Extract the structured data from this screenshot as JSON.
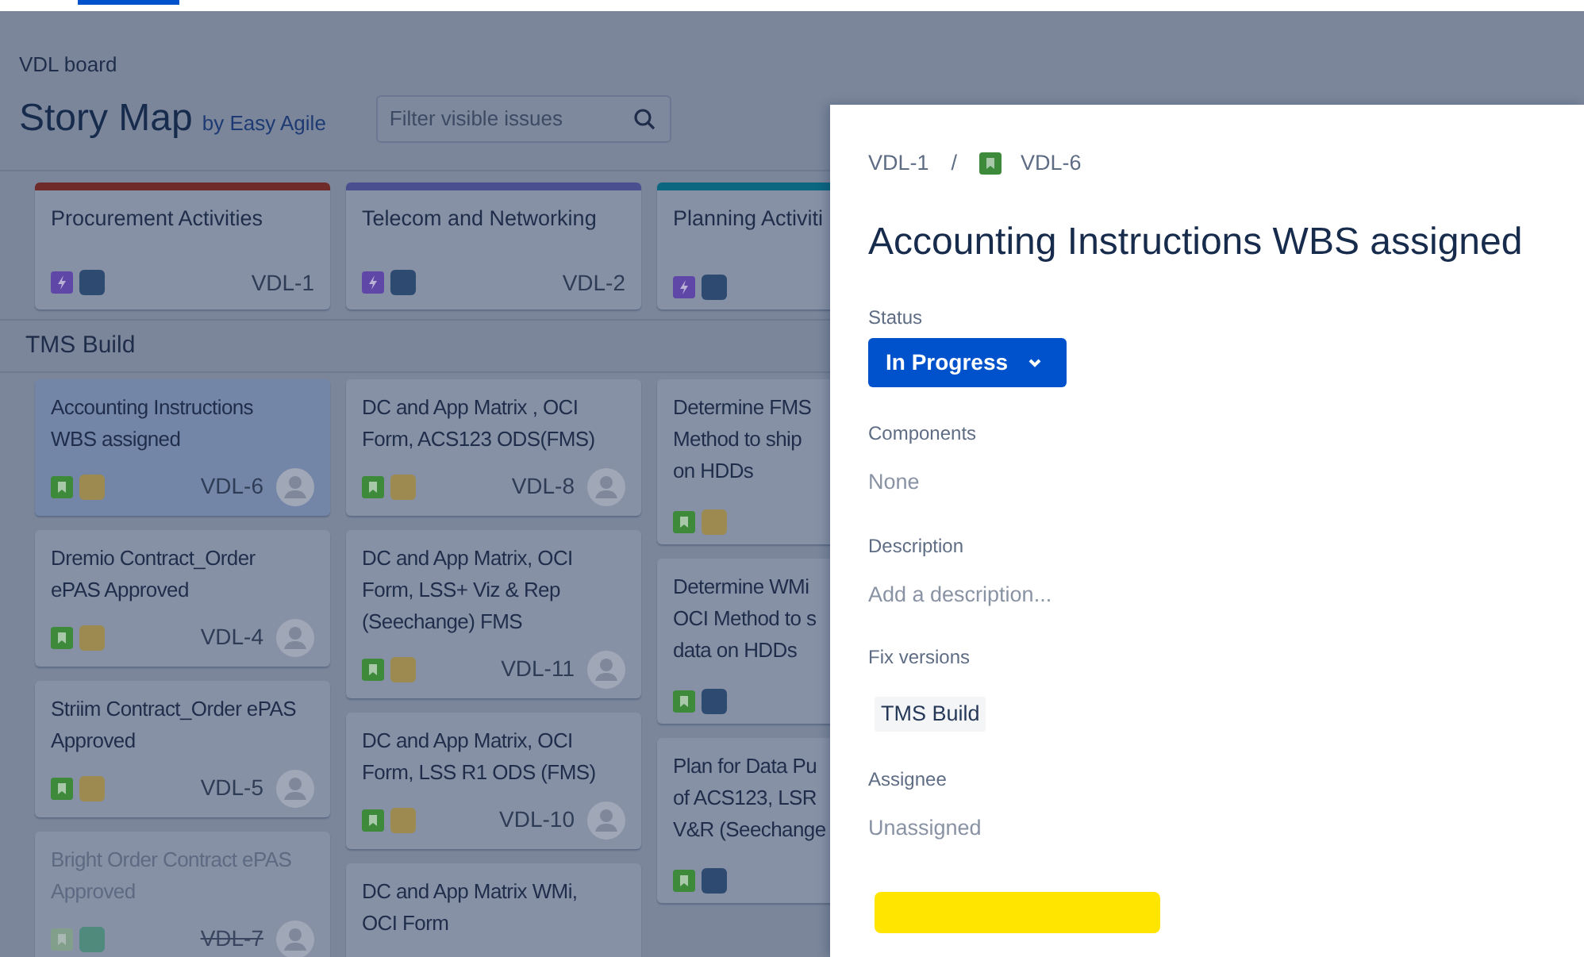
{
  "board": {
    "breadcrumb": "VDL board",
    "title": "Story Map",
    "subtitle": "by Easy Agile",
    "filter": {
      "placeholder": "Filter visible issues"
    },
    "epics": [
      {
        "title": "Procurement Activities",
        "key": "VDL-1",
        "color": "#6f2a2a"
      },
      {
        "title": "Telecom and Networking",
        "key": "VDL-2",
        "color": "#4a4f8f"
      },
      {
        "title": "Planning Activiti",
        "color": "#0b6680"
      }
    ],
    "release": "TMS Build",
    "columns": [
      [
        {
          "title_lines": [
            "Accounting Instructions",
            "WBS assigned"
          ],
          "key": "VDL-6",
          "selected": true,
          "done": false,
          "color": "#9c8a50"
        },
        {
          "title_lines": [
            "Dremio Contract_Order",
            "ePAS Approved"
          ],
          "key": "VDL-4",
          "selected": false,
          "done": false,
          "color": "#9c8a50"
        },
        {
          "title_lines": [
            "Striim Contract_Order ePAS",
            "Approved"
          ],
          "key": "VDL-5",
          "selected": false,
          "done": false,
          "color": "#9c8a50"
        },
        {
          "title_lines": [
            "Bright Order Contract ePAS",
            "Approved"
          ],
          "key": "VDL-7",
          "selected": false,
          "done": true,
          "color": "#4f8a7d"
        }
      ],
      [
        {
          "title_lines": [
            "DC and App Matrix , OCI",
            "Form, ACS123 ODS(FMS)"
          ],
          "key": "VDL-8",
          "selected": false,
          "done": false,
          "color": "#9c8a50"
        },
        {
          "title_lines": [
            "DC and App Matrix, OCI",
            "Form, LSS+ Viz & Rep",
            "(Seechange) FMS"
          ],
          "key": "VDL-11",
          "selected": false,
          "done": false,
          "color": "#9c8a50"
        },
        {
          "title_lines": [
            "DC and App Matrix, OCI",
            "Form, LSS R1 ODS (FMS)"
          ],
          "key": "VDL-10",
          "selected": false,
          "done": false,
          "color": "#9c8a50"
        },
        {
          "title_lines": [
            "DC and App Matrix WMi,",
            "OCI Form"
          ],
          "selected": false
        }
      ],
      [
        {
          "title_lines": [
            "Determine FMS",
            "Method to ship",
            "on HDDs"
          ],
          "selected": false,
          "done": false,
          "color": "#9c8a50"
        },
        {
          "title_lines": [
            "Determine WMi",
            "OCI Method to s",
            "data on HDDs"
          ],
          "selected": false,
          "done": false,
          "color": "#2e4a70"
        },
        {
          "title_lines": [
            "Plan for Data Pu",
            "of ACS123, LSR",
            "V&R (Seechange"
          ],
          "selected": false,
          "done": false,
          "color": "#2e4a70"
        }
      ]
    ]
  },
  "panel": {
    "breadcrumb": [
      {
        "label": "VDL-1"
      },
      {
        "label": "/",
        "kind": "separator"
      },
      {
        "label": "VDL-6",
        "kind": "story"
      }
    ],
    "title": "Accounting Instructions WBS assigned",
    "status": {
      "label": "Status",
      "value": "In Progress"
    },
    "fields": [
      {
        "label": "Components",
        "value": "None",
        "kind": "text"
      },
      {
        "label": "Description",
        "placeholder": "Add a description...",
        "kind": "placeholder"
      },
      {
        "label": "Fix versions",
        "value": "TMS Build",
        "kind": "tag"
      },
      {
        "label": "Assignee",
        "value": "Unassigned",
        "kind": "text"
      }
    ]
  }
}
